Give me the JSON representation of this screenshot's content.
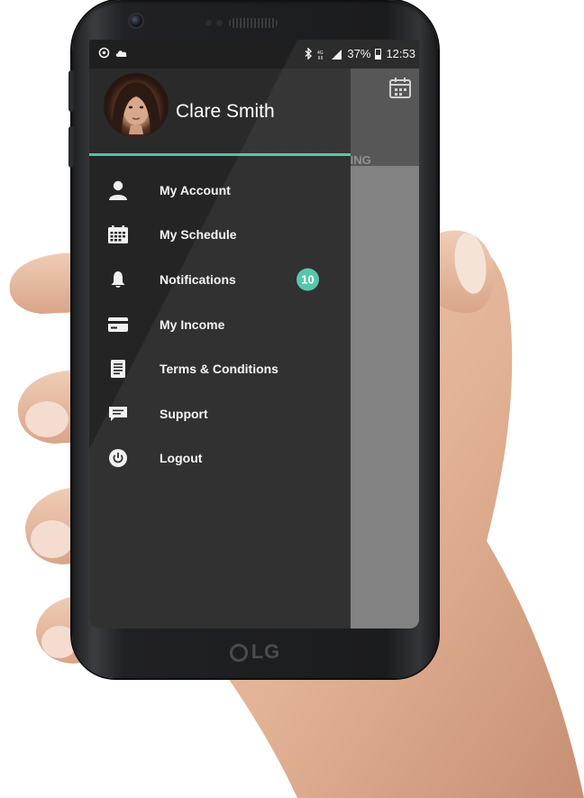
{
  "status_bar": {
    "battery": "37%",
    "time": "12:53"
  },
  "app_header": {
    "tab_fragment": "IING"
  },
  "drawer": {
    "user_name": "Clare Smith",
    "accent_color": "#4dc4a6",
    "items": [
      {
        "label": "My Account",
        "icon": "user-icon"
      },
      {
        "label": "My Schedule",
        "icon": "calendar-icon"
      },
      {
        "label": "Notifications",
        "icon": "bell-icon",
        "badge": "10"
      },
      {
        "label": "My Income",
        "icon": "credit-card-icon"
      },
      {
        "label": "Terms & Conditions",
        "icon": "document-icon"
      },
      {
        "label": "Support",
        "icon": "chat-icon"
      },
      {
        "label": "Logout",
        "icon": "power-icon"
      }
    ]
  },
  "device": {
    "brand": "LG"
  }
}
